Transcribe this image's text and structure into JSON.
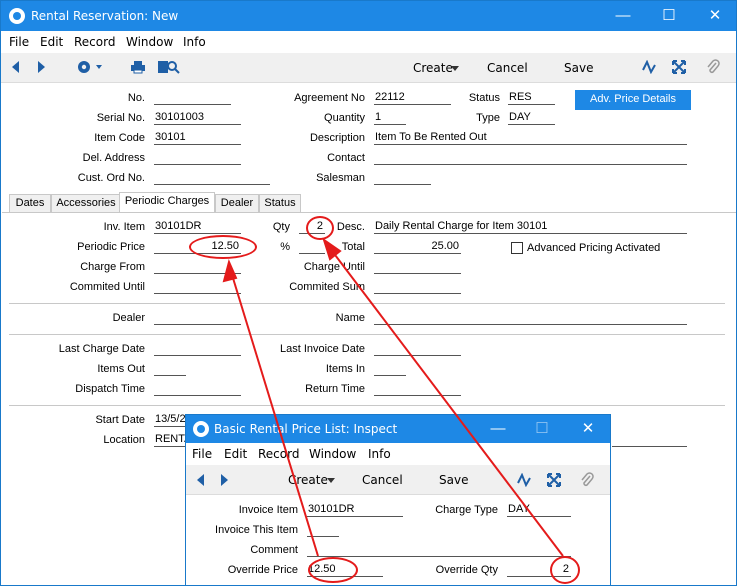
{
  "main": {
    "title": "Rental Reservation: New",
    "menu": [
      "File",
      "Edit",
      "Record",
      "Window",
      "Info"
    ],
    "toolbar": {
      "create": "Create",
      "cancel": "Cancel",
      "save": "Save"
    },
    "header_button": "Adv. Price Details",
    "header": {
      "no_label": "No.",
      "no_value": "",
      "serial_label": "Serial No.",
      "serial_value": "30101003",
      "item_code_label": "Item Code",
      "item_code_value": "30101",
      "del_address_label": "Del. Address",
      "del_address_value": "",
      "cust_ord_label": "Cust. Ord No.",
      "cust_ord_value": "",
      "agreement_label": "Agreement No",
      "agreement_value": "22112",
      "quantity_label": "Quantity",
      "quantity_value": "1",
      "description_label": "Description",
      "description_value": "Item To Be Rented Out",
      "contact_label": "Contact",
      "contact_value": "",
      "salesman_label": "Salesman",
      "salesman_value": "",
      "status_label": "Status",
      "status_value": "RES",
      "type_label": "Type",
      "type_value": "DAY"
    },
    "tabs": [
      "Dates",
      "Accessories",
      "Periodic Charges",
      "Dealer",
      "Status"
    ],
    "periodic": {
      "inv_item_label": "Inv. Item",
      "inv_item_value": "30101DR",
      "qty_label": "Qty",
      "qty_value": "2",
      "desc_label": "Desc.",
      "desc_value": "Daily Rental Charge for Item 30101",
      "periodic_price_label": "Periodic Price",
      "periodic_price_value": "12.50",
      "pct_label": "%",
      "pct_value": "",
      "total_label": "Total",
      "total_value": "25.00",
      "adv_pricing_label": "Advanced Pricing Activated",
      "charge_from_label": "Charge From",
      "charge_from_value": "",
      "charge_until_label": "Charge Until",
      "charge_until_value": "",
      "commited_until_label": "Commited Until",
      "commited_until_value": "",
      "commited_sum_label": "Commited Sum",
      "commited_sum_value": "",
      "dealer_label": "Dealer",
      "dealer_value": "",
      "name_label": "Name",
      "name_value": "",
      "last_charge_label": "Last Charge Date",
      "last_charge_value": "",
      "last_invoice_label": "Last Invoice Date",
      "last_invoice_value": "",
      "items_out_label": "Items Out",
      "items_out_value": "",
      "items_in_label": "Items In",
      "items_in_value": "",
      "dispatch_label": "Dispatch Time",
      "dispatch_value": "",
      "return_label": "Return Time",
      "return_value": "",
      "start_date_label": "Start Date",
      "start_date_value": "13/5/2",
      "location_label": "Location",
      "location_value": "RENTA"
    }
  },
  "inspect": {
    "title": "Basic Rental Price List: Inspect",
    "menu": [
      "File",
      "Edit",
      "Record",
      "Window",
      "Info"
    ],
    "toolbar": {
      "create": "Create",
      "cancel": "Cancel",
      "save": "Save"
    },
    "invoice_item_label": "Invoice Item",
    "invoice_item_value": "30101DR",
    "charge_type_label": "Charge Type",
    "charge_type_value": "DAY",
    "invoice_this_label": "Invoice This Item",
    "invoice_this_value": "",
    "comment_label": "Comment",
    "comment_value": "",
    "override_price_label": "Override Price",
    "override_price_value": "12.50",
    "override_qty_label": "Override Qty",
    "override_qty_value": "2"
  },
  "colors": {
    "accent": "#1e88e5",
    "annotation": "#e41b1b",
    "toolbar_bg": "#f0f0f0"
  }
}
